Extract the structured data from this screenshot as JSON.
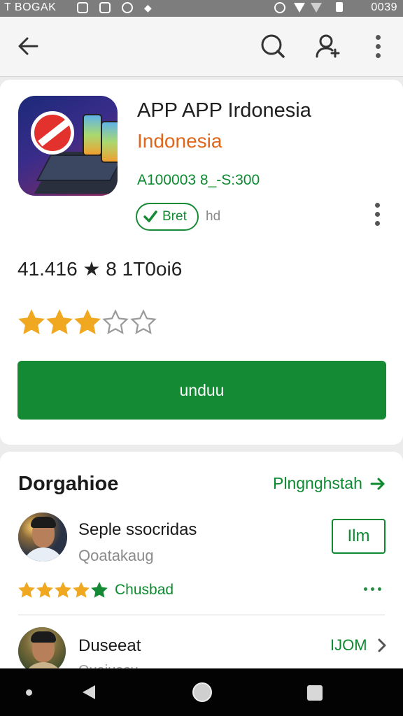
{
  "status_bar": {
    "left_text": "T BOGAK",
    "right_text": "0039"
  },
  "app": {
    "title": "APP APP Irdonesia",
    "developer": "Indonesia",
    "meta": "А100003 8_-S:300",
    "badge_label": "Bret",
    "badge_side_text": "hd",
    "stats_text": "41.416 ★ 8  1T0oi6",
    "rating_stars": 3,
    "rating_max": 5,
    "install_label": "unduu"
  },
  "reviews_section": {
    "title": "Dorgahioe",
    "see_all_label": "Plngnghstah",
    "reviews": [
      {
        "name": "Seple ssocridas",
        "subtitle": "Qoatakaug",
        "button_label": "Ilm",
        "rating_stars": 4.5,
        "rating_label": "Chusbad"
      },
      {
        "name": "Duseeat",
        "subtitle": "Quaiuasu",
        "link_label": "IJOM"
      }
    ]
  },
  "colors": {
    "accent_green": "#138a33",
    "developer_orange": "#e0661c",
    "star_gold": "#f0a821"
  },
  "icons": [
    "back-arrow-icon",
    "search-icon",
    "account-add-icon",
    "more-vert-icon",
    "check-icon",
    "star-icon",
    "arrow-right-icon",
    "chevron-right-icon",
    "nav-back-icon",
    "nav-home-icon",
    "nav-recents-icon"
  ]
}
